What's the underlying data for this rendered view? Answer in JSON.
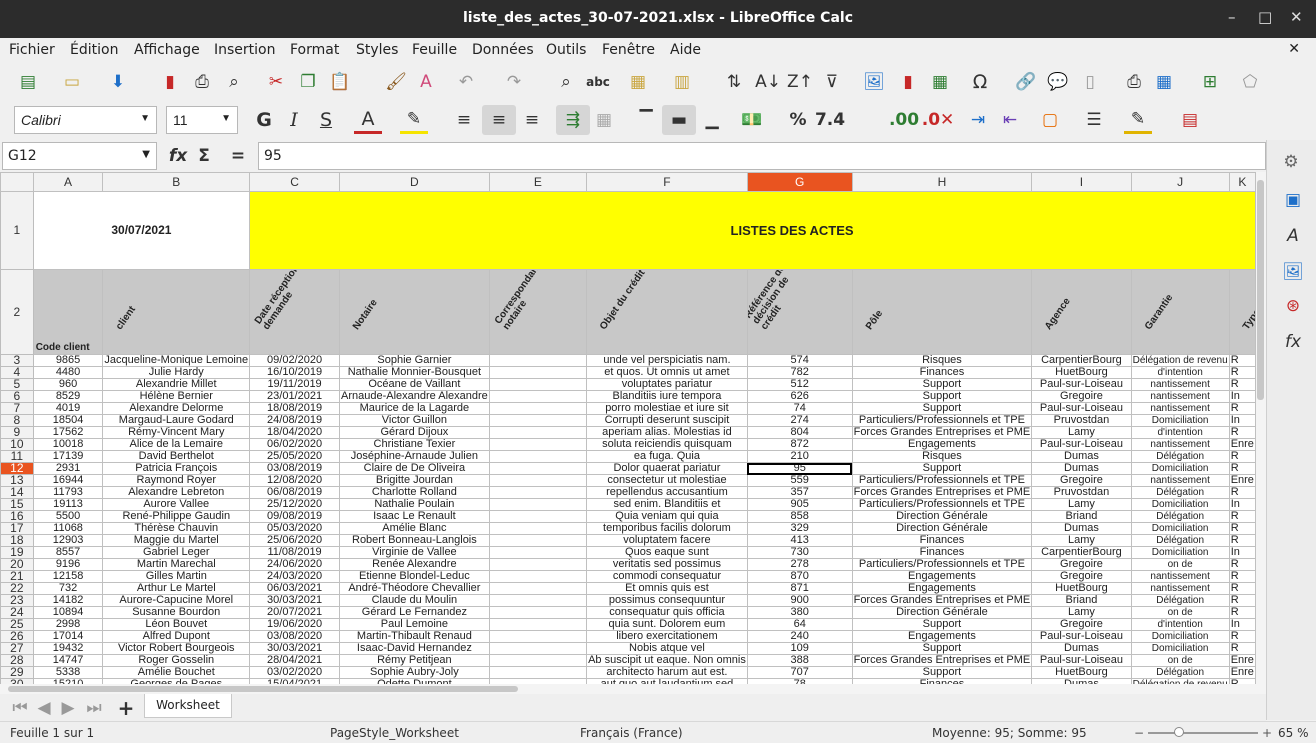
{
  "window": {
    "title": "liste_des_actes_30-07-2021.xlsx - LibreOffice Calc",
    "minimize": "–",
    "maximize": "□",
    "close": "✕"
  },
  "menu": [
    "Fichier",
    "Édition",
    "Affichage",
    "Insertion",
    "Format",
    "Styles",
    "Feuille",
    "Données",
    "Outils",
    "Fenêtre",
    "Aide"
  ],
  "toolbar2": {
    "font_name": "Calibri",
    "font_size": "11"
  },
  "formula_bar": {
    "cell_ref": "G12",
    "value": "95"
  },
  "columns": [
    "A",
    "B",
    "C",
    "D",
    "E",
    "F",
    "G",
    "H",
    "I",
    "J",
    "K"
  ],
  "title_row": {
    "date": "30/07/2021",
    "title": "LISTES DES ACTES"
  },
  "headers": [
    "Code client",
    "client",
    "Date réception demande",
    "Notaire",
    "Correspondant notaire",
    "Objet du crédit",
    "Référence de la décision de crédit",
    "Pôle",
    "Agence",
    "Garantie",
    "Type"
  ],
  "rows": [
    [
      "3",
      "9865",
      "Jacqueline-Monique Lemoine",
      "09/02/2020",
      "Sophie Garnier",
      "",
      "unde vel perspiciatis nam.",
      "574",
      "Risques",
      "CarpentierBourg",
      "Délégation de revenu",
      "R"
    ],
    [
      "4",
      "4480",
      "Julie Hardy",
      "16/10/2019",
      "Nathalie Monnier-Bousquet",
      "",
      "et quos. Ut omnis ut amet",
      "782",
      "Finances",
      "HuetBourg",
      "d'intention",
      "R"
    ],
    [
      "5",
      "960",
      "Alexandrie Millet",
      "19/11/2019",
      "Océane de Vaillant",
      "",
      "voluptates pariatur",
      "512",
      "Support",
      "Paul-sur-Loiseau",
      "nantissement",
      "R"
    ],
    [
      "6",
      "8529",
      "Hélène Bernier",
      "23/01/2021",
      "Arnaude-Alexandre Alexandre",
      "",
      "Blanditiis iure tempora",
      "626",
      "Support",
      "Gregoire",
      "nantissement",
      "In"
    ],
    [
      "7",
      "4019",
      "Alexandre Delorme",
      "18/08/2019",
      "Maurice de la Lagarde",
      "",
      "porro molestiae et iure sit",
      "74",
      "Support",
      "Paul-sur-Loiseau",
      "nantissement",
      "R"
    ],
    [
      "8",
      "18504",
      "Margaud-Laure Godard",
      "24/08/2019",
      "Victor Guillon",
      "",
      "Corrupti deserunt suscipit",
      "274",
      "Particuliers/Professionnels et TPE",
      "Pruvostdan",
      "Domiciliation",
      "In"
    ],
    [
      "9",
      "17562",
      "Rémy-Vincent Mary",
      "18/04/2020",
      "Gérard Dijoux",
      "",
      "aperiam alias. Molestias id",
      "804",
      "Forces Grandes Entreprises et PME",
      "Lamy",
      "d'intention",
      "R"
    ],
    [
      "10",
      "10018",
      "Alice de la Lemaire",
      "06/02/2020",
      "Christiane Texier",
      "",
      "soluta reiciendis quisquam",
      "872",
      "Engagements",
      "Paul-sur-Loiseau",
      "nantissement",
      "Enre"
    ],
    [
      "11",
      "17139",
      "David Berthelot",
      "25/05/2020",
      "Joséphine-Arnaude Julien",
      "",
      "ea fuga. Quia",
      "210",
      "Risques",
      "Dumas",
      "Délégation",
      "R"
    ],
    [
      "12",
      "2931",
      "Patricia François",
      "03/08/2019",
      "Claire de De Oliveira",
      "",
      "Dolor quaerat pariatur",
      "95",
      "Support",
      "Dumas",
      "Domiciliation",
      "R"
    ],
    [
      "13",
      "16944",
      "Raymond Royer",
      "12/08/2020",
      "Brigitte Jourdan",
      "",
      "consectetur ut molestiae",
      "559",
      "Particuliers/Professionnels et TPE",
      "Gregoire",
      "nantissement",
      "Enre"
    ],
    [
      "14",
      "11793",
      "Alexandre Lebreton",
      "06/08/2019",
      "Charlotte Rolland",
      "",
      "repellendus accusantium",
      "357",
      "Forces Grandes Entreprises et PME",
      "Pruvostdan",
      "Délégation",
      "R"
    ],
    [
      "15",
      "19113",
      "Aurore Vallee",
      "25/12/2020",
      "Nathalie Poulain",
      "",
      "sed enim. Blanditiis et",
      "905",
      "Particuliers/Professionnels et TPE",
      "Lamy",
      "Domiciliation",
      "In"
    ],
    [
      "16",
      "5500",
      "René-Philippe Gaudin",
      "09/08/2019",
      "Isaac Le Renault",
      "",
      "Quia veniam qui quia",
      "858",
      "Direction Générale",
      "Briand",
      "Délégation",
      "R"
    ],
    [
      "17",
      "11068",
      "Thérèse Chauvin",
      "05/03/2020",
      "Amélie Blanc",
      "",
      "temporibus facilis dolorum",
      "329",
      "Direction Générale",
      "Dumas",
      "Domiciliation",
      "R"
    ],
    [
      "18",
      "12903",
      "Maggie du Martel",
      "25/06/2020",
      "Robert Bonneau-Langlois",
      "",
      "voluptatem facere",
      "413",
      "Finances",
      "Lamy",
      "Délégation",
      "R"
    ],
    [
      "19",
      "8557",
      "Gabriel Leger",
      "11/08/2019",
      "Virginie de Vallee",
      "",
      "Quos eaque sunt",
      "730",
      "Finances",
      "CarpentierBourg",
      "Domiciliation",
      "In"
    ],
    [
      "20",
      "9196",
      "Martin Marechal",
      "24/06/2020",
      "Renée Alexandre",
      "",
      "veritatis sed possimus",
      "278",
      "Particuliers/Professionnels et TPE",
      "Gregoire",
      "on de",
      "R"
    ],
    [
      "21",
      "12158",
      "Gilles Martin",
      "24/03/2020",
      "Étienne Blondel-Leduc",
      "",
      "commodi consequatur",
      "870",
      "Engagements",
      "Gregoire",
      "nantissement",
      "R"
    ],
    [
      "22",
      "732",
      "Arthur Le Martel",
      "06/03/2021",
      "André-Théodore Chevallier",
      "",
      "Et omnis quis est",
      "871",
      "Engagements",
      "HuetBourg",
      "nantissement",
      "R"
    ],
    [
      "23",
      "14182",
      "Aurore-Capucine Morel",
      "30/03/2021",
      "Claude du Moulin",
      "",
      "possimus consequuntur",
      "900",
      "Forces Grandes Entreprises et PME",
      "Briand",
      "Délégation",
      "R"
    ],
    [
      "24",
      "10894",
      "Susanne Bourdon",
      "20/07/2021",
      "Gérard Le Fernandez",
      "",
      "consequatur quis officia",
      "380",
      "Direction Générale",
      "Lamy",
      "on de",
      "R"
    ],
    [
      "25",
      "2998",
      "Léon Bouvet",
      "19/06/2020",
      "Paul Lemoine",
      "",
      "quia sunt. Dolorem eum",
      "64",
      "Support",
      "Gregoire",
      "d'intention",
      "In"
    ],
    [
      "26",
      "17014",
      "Alfred Dupont",
      "03/08/2020",
      "Martin-Thibault Renaud",
      "",
      "libero exercitationem",
      "240",
      "Engagements",
      "Paul-sur-Loiseau",
      "Domiciliation",
      "R"
    ],
    [
      "27",
      "19432",
      "Victor Robert Bourgeois",
      "30/03/2021",
      "Isaac-David Hernandez",
      "",
      "Nobis atque vel",
      "109",
      "Support",
      "Dumas",
      "Domiciliation",
      "R"
    ],
    [
      "28",
      "14747",
      "Roger Gosselin",
      "28/04/2021",
      "Rémy Petitjean",
      "",
      "Ab suscipit ut eaque. Non omnis",
      "388",
      "Forces Grandes Entreprises et PME",
      "Paul-sur-Loiseau",
      "on de",
      "Enre"
    ],
    [
      "29",
      "5338",
      "Amélie Bouchet",
      "03/02/2020",
      "Sophie Aubry-Joly",
      "",
      "architecto harum aut est.",
      "707",
      "Support",
      "HuetBourg",
      "Délégation",
      "Enre"
    ],
    [
      "30",
      "15210",
      "Georges de Pages",
      "15/04/2021",
      "Odette Dumont",
      "",
      "aut quo aut laudantium sed",
      "78",
      "Finances",
      "Dumas",
      "Délégation de revenu",
      "R"
    ]
  ],
  "sheet_tabs": [
    "Worksheet"
  ],
  "status": {
    "sheet": "Feuille 1 sur 1",
    "style": "PageStyle_Worksheet",
    "lang": "Français (France)",
    "summary": "Moyenne: 95; Somme: 95",
    "zoom": "65 %"
  }
}
